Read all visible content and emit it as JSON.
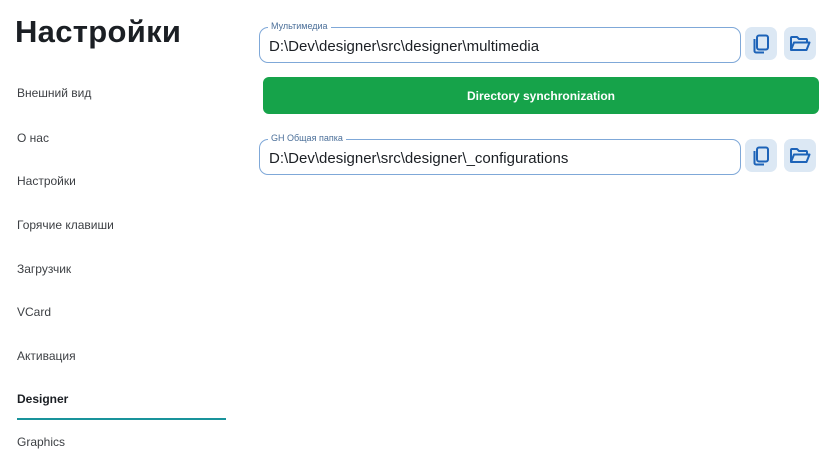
{
  "sidebar": {
    "title": "Настройки",
    "items": [
      {
        "label": "Внешний вид"
      },
      {
        "label": "О нас"
      },
      {
        "label": "Настройки"
      },
      {
        "label": "Горячие клавиши"
      },
      {
        "label": "Загрузчик"
      },
      {
        "label": "VCard"
      },
      {
        "label": "Активация"
      },
      {
        "label": "Designer",
        "active": true
      },
      {
        "label": "Graphics"
      }
    ]
  },
  "main": {
    "multimedia": {
      "legend": "Мультимедиа",
      "value": "D:\\Dev\\designer\\src\\designer\\multimedia",
      "copy_icon": "copy-icon",
      "folder_icon": "folder-open-icon"
    },
    "sync_button": {
      "label": "Directory synchronization",
      "color": "#16a34a"
    },
    "shared_folder": {
      "legend": "GH Общая папка",
      "value": "D:\\Dev\\designer\\src\\designer\\_configurations",
      "copy_icon": "copy-icon",
      "folder_icon": "folder-open-icon"
    }
  },
  "colors": {
    "accent_teal": "#19939b",
    "field_border": "#7fa8d8",
    "icon_button_bg": "#dce8f4",
    "icon_color": "#1d63b8"
  }
}
